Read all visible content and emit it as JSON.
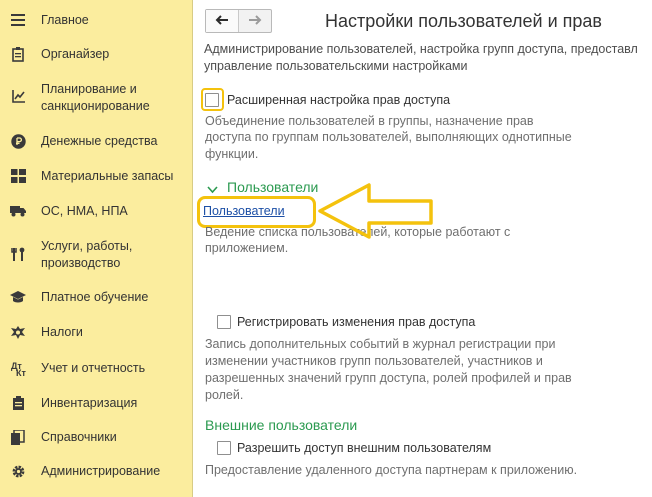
{
  "sidebar": {
    "items": [
      {
        "label": "Главное",
        "icon": "hamburger-icon"
      },
      {
        "label": "Органайзер",
        "icon": "notepad-icon"
      },
      {
        "label": "Планирование и",
        "label2": "санкционирование",
        "icon": "planning-icon"
      },
      {
        "label": "Денежные средства",
        "icon": "ruble-icon"
      },
      {
        "label": "Материальные запасы",
        "icon": "grid-icon"
      },
      {
        "label": "ОС, НМА, НПА",
        "icon": "truck-icon"
      },
      {
        "label": "Услуги, работы,",
        "label2": "производство",
        "icon": "tools-icon"
      },
      {
        "label": "Платное обучение",
        "icon": "graduation-cap-icon"
      },
      {
        "label": "Налоги",
        "icon": "emblem-icon"
      },
      {
        "label": "Учет и отчетность",
        "icon": "accounting-icon"
      },
      {
        "label": "Инвентаризация",
        "icon": "inventory-icon"
      },
      {
        "label": "Справочники",
        "icon": "reference-books-icon"
      },
      {
        "label": "Администрирование",
        "icon": "gear-icon"
      }
    ]
  },
  "header": {
    "title": "Настройки пользователей и прав"
  },
  "main": {
    "intro_line1": "Администрирование пользователей, настройка групп доступа, предоставл",
    "intro_line2": "управление пользовательскими настройками",
    "advanced_rights": {
      "label": "Расширенная настройка прав доступа",
      "checked": false,
      "note1": "Объединение пользователей в группы, назначение прав",
      "note2": "доступа по группам пользователей, выполняющих однотипные",
      "note3": "функции."
    },
    "users_section": {
      "title": "Пользователи",
      "link": "Пользователи",
      "note1": "Ведение списка пользователей, которые работают с",
      "note2": "приложением."
    },
    "log_changes": {
      "label": "Регистрировать изменения прав доступа",
      "checked": false,
      "note1": "Запись дополнительных событий в журнал регистрации при",
      "note2": "изменении участников групп пользователей, участников и",
      "note3": "разрешенных значений групп доступа, ролей профилей и прав",
      "note4": "ролей."
    },
    "external_section": {
      "title": "Внешние пользователи",
      "allow_label": "Разрешить доступ внешним пользователям",
      "checked": false,
      "note1": "Предоставление удаленного доступа партнерам к приложению."
    }
  },
  "colors": {
    "sidebar_bg": "#fbed9e",
    "section_green": "#2b9a50",
    "link_blue": "#1c4fa6",
    "highlight_yellow": "#f4c20d"
  }
}
